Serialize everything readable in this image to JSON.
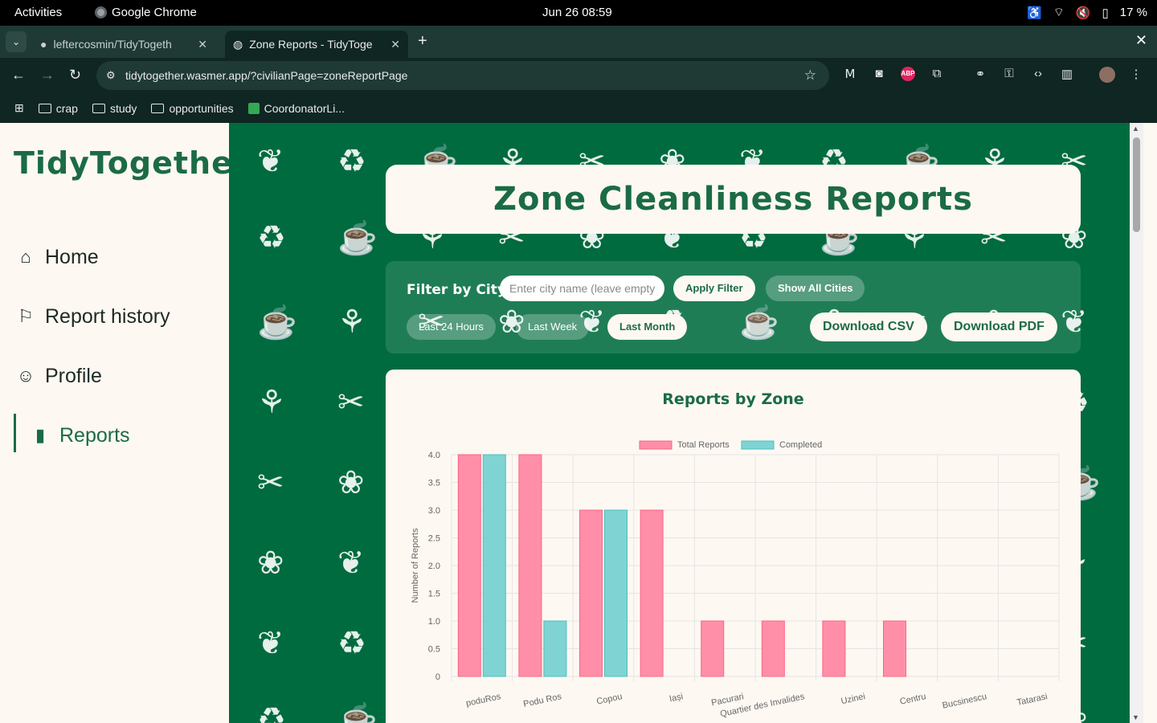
{
  "system": {
    "activities": "Activities",
    "app": "Google Chrome",
    "clock": "Jun 26  08:59",
    "battery": "17 %"
  },
  "browser": {
    "tabs": [
      {
        "title": "leftercosmin/TidyTogeth",
        "active": false
      },
      {
        "title": "Zone Reports - TidyToge",
        "active": true
      }
    ],
    "url": "tidytogether.wasmer.app/?civilianPage=zoneReportPage",
    "bookmarks": [
      "crap",
      "study",
      "opportunities",
      "CoordonatorLi..."
    ]
  },
  "sidebar": {
    "brand": "TidyTogether",
    "items": [
      {
        "label": "Home",
        "icon": "home-icon"
      },
      {
        "label": "Report history",
        "icon": "flag-icon"
      },
      {
        "label": "Profile",
        "icon": "user-circle-icon"
      },
      {
        "label": "Reports",
        "icon": "bar-chart-icon",
        "active": true
      }
    ]
  },
  "main": {
    "title": "Zone Cleanliness Reports",
    "filter": {
      "label": "Filter by City:",
      "placeholder": "Enter city name (leave empty",
      "apply": "Apply Filter",
      "show_all": "Show All Cities",
      "periods": [
        "Last 24 Hours",
        "Last Week",
        "Last Month"
      ],
      "active_period": "Last Month",
      "download_csv": "Download CSV",
      "download_pdf": "Download PDF"
    }
  },
  "colors": {
    "brand_green": "#1b6b45",
    "background_green": "#006b3f",
    "total_color": "#ff8fa8",
    "completed_color": "#7fd3d3"
  },
  "chart_data": {
    "type": "bar",
    "title": "Reports by Zone",
    "ylabel": "Number of Reports",
    "xlabel": "",
    "ylim": [
      0,
      4
    ],
    "yticks": [
      "4.0",
      "3.5",
      "3.0",
      "2.5",
      "2.0",
      "1.5",
      "1.0",
      "0.5",
      "0"
    ],
    "categories": [
      "poduRos",
      "Podu Ros",
      "Copou",
      "Iași",
      "Pacurari",
      "Quartier des Invalides",
      "Uzinei",
      "Centru",
      "Bucsinescu",
      "Tatarasi"
    ],
    "series": [
      {
        "name": "Total Reports",
        "values": [
          4,
          4,
          3,
          3,
          1,
          1,
          1,
          1,
          0,
          0
        ]
      },
      {
        "name": "Completed",
        "values": [
          4,
          1,
          3,
          0,
          0,
          0,
          0,
          0,
          0,
          0
        ]
      }
    ],
    "legend": "top-center",
    "grid": true
  }
}
